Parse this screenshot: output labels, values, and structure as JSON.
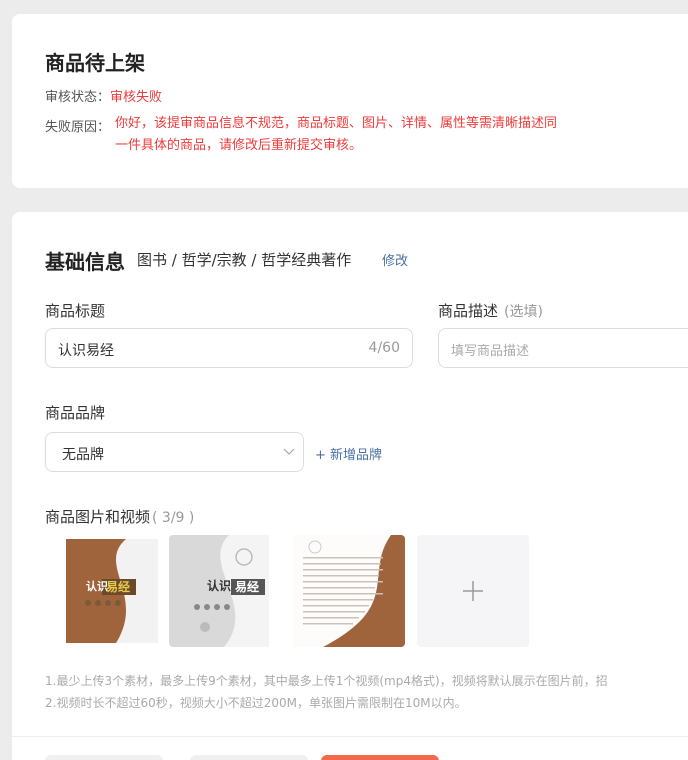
{
  "status": {
    "title": "商品待上架",
    "review_label": "审核状态：",
    "review_value": "审核失败",
    "reason_label": "失败原因：",
    "reason_line1": "你好，该提审商品信息不规范，商品标题、图片、详情、属性等需清晰描述同",
    "reason_line2": "一件具体的商品，请修改后重新提交审核。"
  },
  "basic": {
    "title": "基础信息",
    "category": "图书 / 哲学/宗教 / 哲学经典著作",
    "modify_link": "修改",
    "product_title_label": "商品标题",
    "product_title_value": "认识易经",
    "product_title_count": "4/60",
    "desc_label": "商品描述",
    "desc_optional": "(选填)",
    "desc_placeholder": "填写商品描述",
    "brand_label": "商品品牌",
    "brand_value": "无品牌",
    "add_brand_link": "+ 新增品牌",
    "media_label": "商品图片和视频",
    "media_count": "( 3/9 )",
    "hint_line1": "1.最少上传3个素材，最多上传9个素材，其中最多上传1个视频(mp4格式)，视频将默认展示在图片前，招",
    "hint_line2": "2.视频时长不超过60秒，视频大小不超过200M，单张图片需限制在10M以内。"
  },
  "images": [
    {
      "name": "book-cover-front",
      "title": "认识易经"
    },
    {
      "name": "book-cover-gray",
      "title": "认识易经"
    },
    {
      "name": "book-page-text",
      "title": ""
    }
  ],
  "colors": {
    "accent_red": "#ee3b3b",
    "link_blue": "#4a6fa5",
    "cover_brown": "#a0643c",
    "cta": "#f26a4b"
  }
}
